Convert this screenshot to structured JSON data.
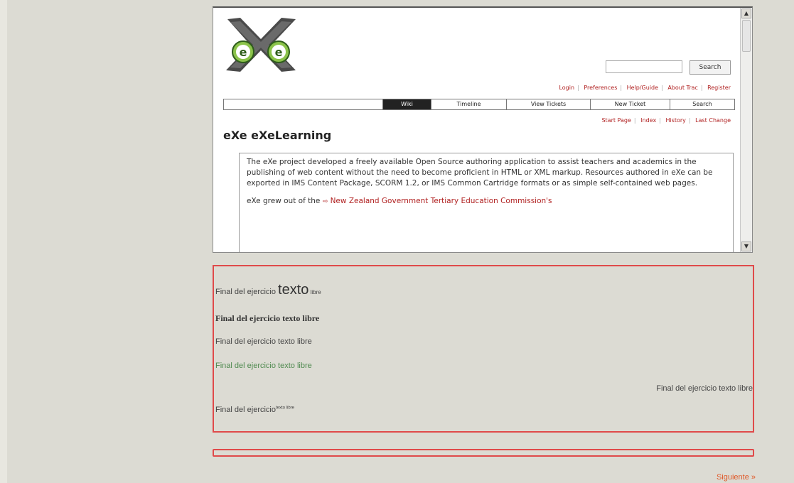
{
  "trac": {
    "search_button": "Search",
    "metanav": [
      "Login",
      "Preferences",
      "Help/Guide",
      "About Trac",
      "Register"
    ],
    "mainnav": [
      "Wiki",
      "Timeline",
      "View Tickets",
      "New Ticket",
      "Search"
    ],
    "mainnav_active": "Wiki",
    "ctxnav": [
      "Start Page",
      "Index",
      "History",
      "Last Change"
    ],
    "page_title": "eXe eXeLearning",
    "paragraph1": "The eXe project developed a freely available Open Source authoring application to assist teachers and academics in the publishing of web content without the need to become proficient in HTML or XML markup. Resources authored in eXe can be exported in IMS Content Package, SCORM 1.2, or IMS Common Cartridge formats or as simple self-contained web pages.",
    "paragraph2_prefix": "eXe grew out of the ",
    "paragraph2_link": "New Zealand Government Tertiary Education Commission's"
  },
  "exercise": {
    "line1": {
      "a": "Final del ejercicio ",
      "b": "texto",
      "c": " libre"
    },
    "line2": "Final del ejercicio texto libre",
    "line3": "Final del ejercicio texto libre",
    "line4": "Final del ejercicio texto libre",
    "line5": "Final del ejercicio texto libre",
    "line6": {
      "a": "Final del ejercicio",
      "b": "texto libre"
    }
  },
  "next_link": "Siguiente »",
  "colors": {
    "page_bg": "#dcdbd3",
    "box_border": "#e04a4a",
    "link_red": "#b02020",
    "green_text": "#4f8a4f",
    "next_link": "#e05a2a"
  },
  "icons": [
    "exe-logo-icon",
    "scroll-up-icon",
    "scroll-down-icon",
    "external-link-icon"
  ]
}
